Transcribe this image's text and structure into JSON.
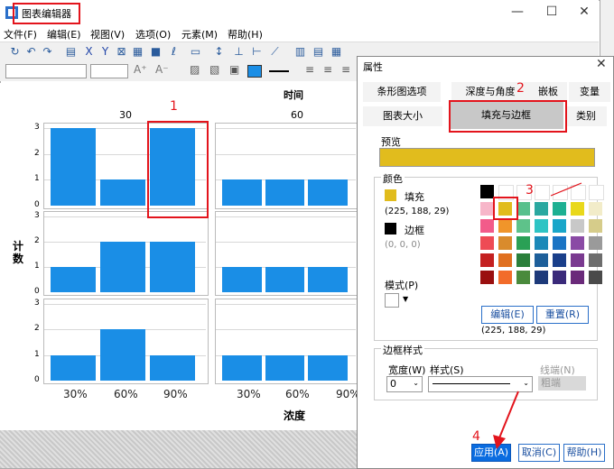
{
  "window": {
    "title": "图表编辑器",
    "minimize": "—",
    "maximize": "☐",
    "close": "✕"
  },
  "menu": [
    "文件(F)",
    "编辑(E)",
    "视图(V)",
    "选项(O)",
    "元素(M)",
    "帮助(H)"
  ],
  "chart_data": {
    "type": "bar",
    "column_title": "时间",
    "columns": [
      "30",
      "60"
    ],
    "ylabel": "计数",
    "xlabel": "浓度",
    "categories": [
      "30%",
      "60%",
      "90%"
    ],
    "ylim": [
      0,
      3
    ],
    "yticks": [
      "3",
      "2",
      "1",
      "0"
    ],
    "panels": [
      {
        "column": "30",
        "row": 1,
        "values": [
          3,
          1,
          3
        ]
      },
      {
        "column": "60",
        "row": 1,
        "values": [
          1,
          1,
          1
        ]
      },
      {
        "column": "30",
        "row": 2,
        "values": [
          1,
          2,
          2
        ]
      },
      {
        "column": "60",
        "row": 2,
        "values": [
          1,
          1,
          1
        ]
      },
      {
        "column": "30",
        "row": 3,
        "values": [
          1,
          2,
          1
        ]
      },
      {
        "column": "60",
        "row": 3,
        "values": [
          1,
          1,
          1
        ]
      }
    ],
    "bar_color": "#1a8ee6"
  },
  "annotations": {
    "n1": "1",
    "n2": "2",
    "n3": "3",
    "n4": "4",
    "color": "#e3141c"
  },
  "dialog": {
    "title": "属性",
    "close": "✕",
    "tabs_row1": [
      "条形图选项",
      "深度与角度",
      "嵌板",
      "变量"
    ],
    "tabs_row2": [
      "图表大小",
      "填充与边框",
      "类别"
    ],
    "preview_label": "预览",
    "preview_color": "#e1bc1d",
    "color_label": "颜色",
    "fill_label": "填充",
    "fill_value": "(225, 188, 29)",
    "border_label": "边框",
    "border_value": "(0, 0, 0)",
    "pattern_label": "模式(P)",
    "edit_button": "编辑(E)",
    "reset_button": "重置(R)",
    "selected_value": "(225, 188, 29)",
    "border_style_label": "边框样式",
    "width_label": "宽度(W)",
    "style_label": "样式(S)",
    "cap_label": "线端(N)",
    "width_value": "0",
    "cap_value": "粗端",
    "apply_button": "应用(A)",
    "cancel_button": "取消(C)",
    "help_button": "帮助(H)"
  },
  "palette": [
    [
      "#000000",
      "#ffffff",
      "#ffffff",
      "#ffffff",
      "#ffffff",
      "#ffffff",
      "#ffffff"
    ],
    [
      "#f7b6c9",
      "#e1bc1d",
      "#58c08c",
      "#2aa8a0",
      "#1db092",
      "#e9d81a",
      "#f2ecc9"
    ],
    [
      "#f25b8a",
      "#f0952a",
      "#5ec28a",
      "#2ec4c4",
      "#19a6c9",
      "#c8c8c8",
      "#d6cc8a"
    ],
    [
      "#ee4b55",
      "#d98b2c",
      "#2aa055",
      "#1b89b8",
      "#1a74c4",
      "#8a4aa5",
      "#9a9a9a"
    ],
    [
      "#c42020",
      "#e07020",
      "#2b7f3b",
      "#1d5f9a",
      "#1a3f8a",
      "#7a3a90",
      "#6d6d6d"
    ],
    [
      "#9a0f0f",
      "#f26c2a",
      "#4a8a3c",
      "#1d3a7a",
      "#3a2a7a",
      "#6a2a7a",
      "#4a4a4a"
    ]
  ]
}
